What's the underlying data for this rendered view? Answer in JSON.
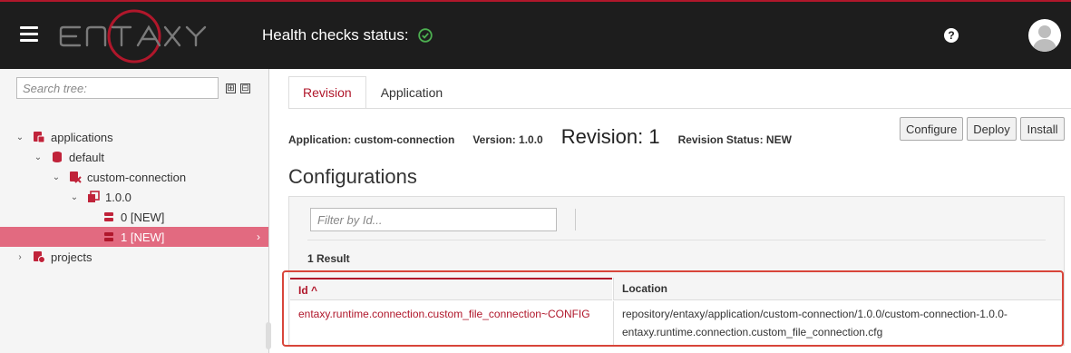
{
  "header": {
    "health_label": "Health checks status:",
    "health_color": "#4caf50",
    "help_icon": "question-circle-icon",
    "avatar_icon": "user-avatar-icon",
    "accent": "#b0172b"
  },
  "sidebar": {
    "search_placeholder": "Search tree:",
    "expand_all": "⊞",
    "collapse_all": "⊟",
    "items": [
      {
        "label": "applications",
        "icon": "applications-folder-icon"
      },
      {
        "label": "default",
        "icon": "database-icon"
      },
      {
        "label": "custom-connection",
        "icon": "application-icon"
      },
      {
        "label": "1.0.0",
        "icon": "version-stack-icon"
      },
      {
        "label": "0 [NEW]",
        "icon": "revision-icon"
      },
      {
        "label": "1 [NEW]",
        "icon": "revision-icon"
      },
      {
        "label": "projects",
        "icon": "projects-folder-icon"
      }
    ]
  },
  "tabs": [
    {
      "label": "Revision",
      "active": true
    },
    {
      "label": "Application",
      "active": false
    }
  ],
  "info": {
    "application": "Application: custom-connection",
    "version": "Version: 1.0.0",
    "revision": "Revision: 1",
    "status": "Revision Status: NEW"
  },
  "actions": {
    "configure": "Configure",
    "deploy": "Deploy",
    "install": "Install"
  },
  "configurations": {
    "title": "Configurations",
    "filter_placeholder": "Filter by Id...",
    "result_count": "1 Result",
    "columns": {
      "id": "Id ^",
      "location": "Location"
    },
    "rows": [
      {
        "id": "entaxy.runtime.connection.custom_file_connection~CONFIG",
        "location": "repository/entaxy/application/custom-connection/1.0.0/custom-connection-1.0.0-entaxy.runtime.connection.custom_file_connection.cfg"
      }
    ]
  }
}
